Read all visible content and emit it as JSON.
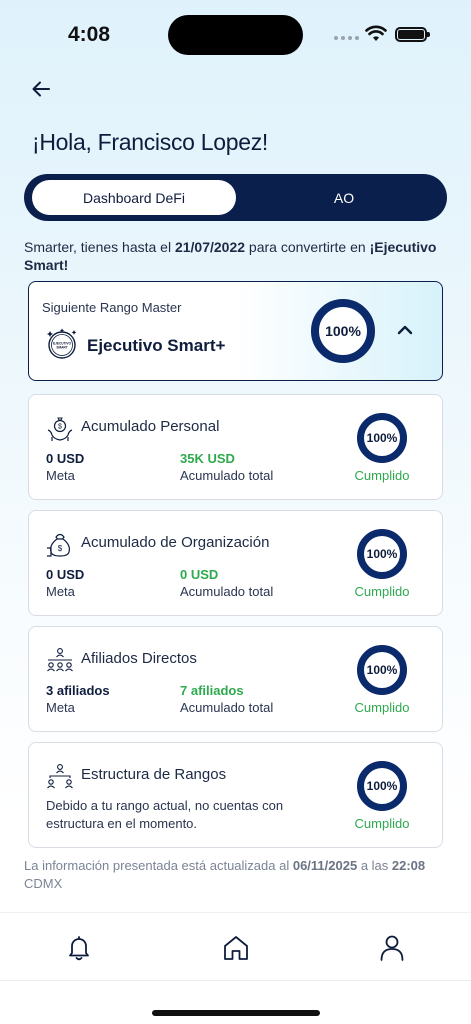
{
  "status": {
    "time": "4:08"
  },
  "greeting": "¡Hola, Francisco Lopez!",
  "tabs": [
    {
      "label": "Dashboard DeFi",
      "active": true
    },
    {
      "label": "AO",
      "active": false
    }
  ],
  "notice": {
    "prefix": "Smarter, tienes hasta el ",
    "date": "21/07/2022",
    "middle": " para convertirte en ",
    "goal": "¡Ejecutivo Smart!"
  },
  "rank": {
    "label": "Siguiente Rango Master",
    "name": "Ejecutivo Smart+",
    "badge_text": "EJECUTIVO SMART",
    "progress_text": "100%",
    "progress": 1.0
  },
  "cards": [
    {
      "title": "Acumulado Personal",
      "icon": "money-hand-icon",
      "meta_value": "0 USD",
      "meta_label": "Meta",
      "acc_value": "35K USD",
      "acc_label": "Acumulado total",
      "progress_text": "100%",
      "progress": 1.0,
      "status": "Cumplido"
    },
    {
      "title": "Acumulado de Organización",
      "icon": "money-bag-icon",
      "meta_value": "0 USD",
      "meta_label": "Meta",
      "acc_value": "0 USD",
      "acc_label": "Acumulado total",
      "progress_text": "100%",
      "progress": 1.0,
      "status": "Cumplido"
    },
    {
      "title": "Afiliados Directos",
      "icon": "team-icon",
      "meta_value": "3 afiliados",
      "meta_label": "Meta",
      "acc_value": "7 afiliados",
      "acc_label": "Acumulado total",
      "progress_text": "100%",
      "progress": 1.0,
      "status": "Cumplido"
    },
    {
      "title": "Estructura de Rangos",
      "icon": "hierarchy-icon",
      "description": "Debido a tu rango actual, no cuentas con estructura en el momento.",
      "progress_text": "100%",
      "progress": 1.0,
      "status": "Cumplido"
    }
  ],
  "footer": {
    "prefix": "La información presentada está actualizada al ",
    "date": "06/11/2025",
    "middle": " a las ",
    "time": "22:08",
    "suffix": " CDMX"
  },
  "tabbar": {
    "items": [
      "bell-icon",
      "home-icon",
      "profile-icon"
    ]
  },
  "colors": {
    "navy": "#0b1f4d",
    "green": "#2eaa4e",
    "ring": "#0b2a6b"
  }
}
